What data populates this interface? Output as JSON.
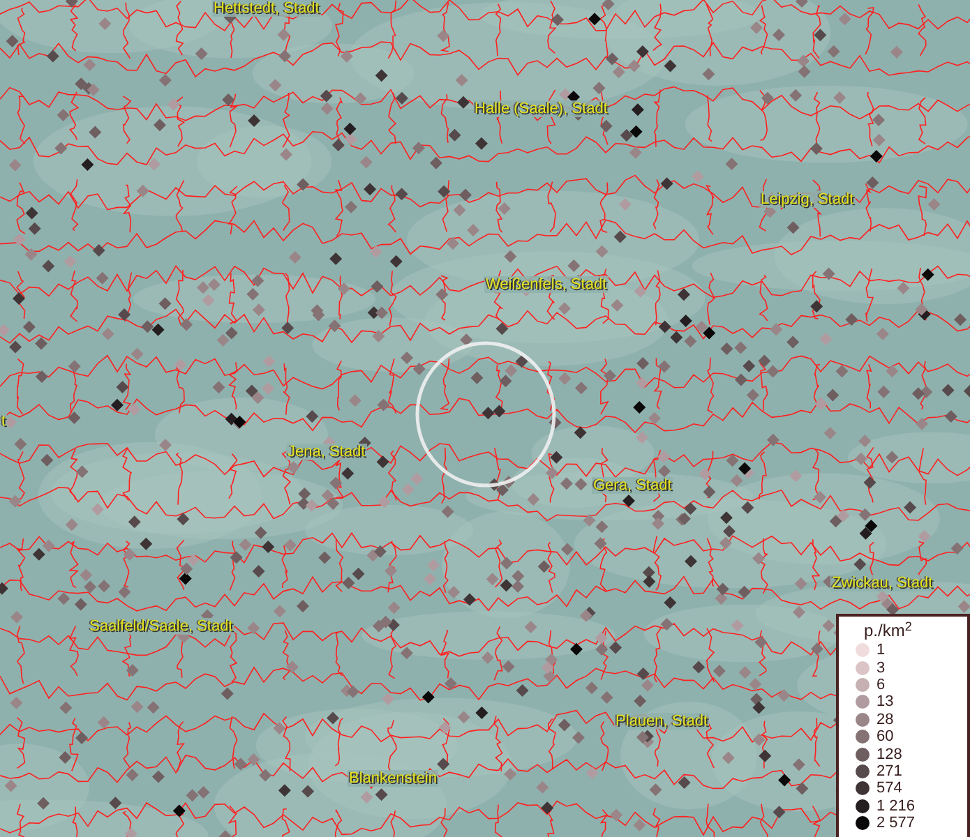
{
  "map": {
    "labels": [
      {
        "text": "Hettstedt, Stadt"
      },
      {
        "text": "Halle (Saale), Stadt"
      },
      {
        "text": "Leipzig, Stadt"
      },
      {
        "text": "Weißenfels, Stadt"
      },
      {
        "text": "t"
      },
      {
        "text": "Jena, Stadt"
      },
      {
        "text": "Gera, Stadt"
      },
      {
        "text": "Zwickau, Stadt"
      },
      {
        "text": "Saalfeld/Saale, Stadt"
      },
      {
        "text": "Plauen, Stadt"
      },
      {
        "text": "Blankenstein"
      }
    ]
  },
  "legend": {
    "title": "p./km$^{2}$",
    "entries": [
      {
        "label": "1",
        "color": "#f0dcdc"
      },
      {
        "label": "3",
        "color": "#dcc4c6"
      },
      {
        "label": "6",
        "color": "#c6b0b2"
      },
      {
        "label": "13",
        "color": "#b09ca0"
      },
      {
        "label": "28",
        "color": "#9a8688"
      },
      {
        "label": "60",
        "color": "#857274"
      },
      {
        "label": "128",
        "color": "#6e5e60"
      },
      {
        "label": "271",
        "color": "#574a4c"
      },
      {
        "label": "574",
        "color": "#3e3436"
      },
      {
        "label": "1 216",
        "color": "#241e20"
      },
      {
        "label": "2 577",
        "color": "#0a0808"
      }
    ]
  }
}
